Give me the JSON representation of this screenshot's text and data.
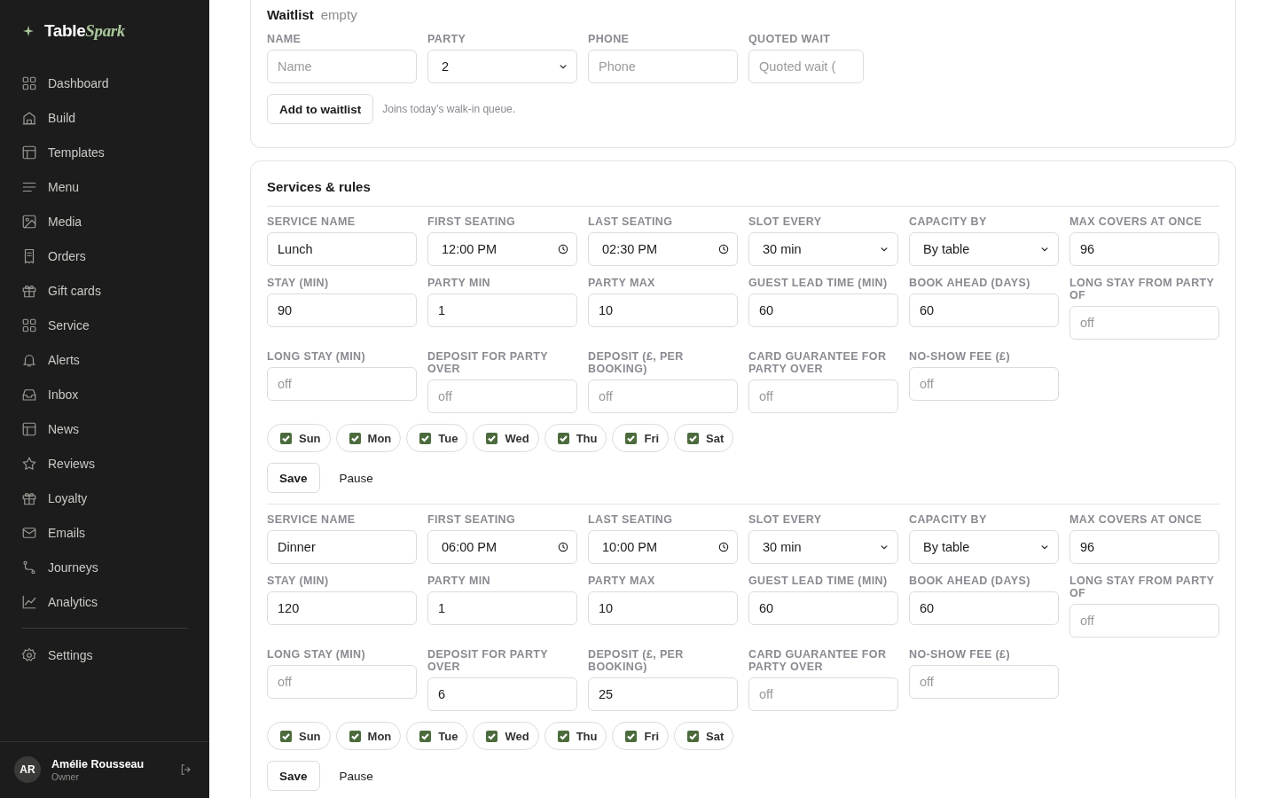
{
  "sidebar": {
    "logo": {
      "plain": "Table",
      "accent": "Spark"
    },
    "items": [
      {
        "label": "Dashboard"
      },
      {
        "label": "Build"
      },
      {
        "label": "Templates"
      },
      {
        "label": "Menu"
      },
      {
        "label": "Media"
      },
      {
        "label": "Orders"
      },
      {
        "label": "Gift cards"
      },
      {
        "label": "Service"
      },
      {
        "label": "Alerts"
      },
      {
        "label": "Inbox"
      },
      {
        "label": "News"
      },
      {
        "label": "Reviews"
      },
      {
        "label": "Loyalty"
      },
      {
        "label": "Emails"
      },
      {
        "label": "Journeys"
      },
      {
        "label": "Analytics"
      }
    ],
    "footer_items": [
      {
        "label": "Settings"
      }
    ],
    "user": {
      "initials": "AR",
      "name": "Amélie Rousseau",
      "role": "Owner"
    }
  },
  "waitlist": {
    "title": "Waitlist",
    "status": "empty",
    "fields": [
      {
        "label": "NAME",
        "kind": "text",
        "placeholder": "Name"
      },
      {
        "label": "PARTY",
        "kind": "select",
        "value": "2"
      },
      {
        "label": "PHONE",
        "kind": "text",
        "placeholder": "Phone"
      },
      {
        "label": "QUOTED WAIT",
        "kind": "text",
        "placeholder": "Quoted wait ("
      }
    ],
    "button": "Add to waitlist",
    "hint": "Joins today’s walk-in queue."
  },
  "services": {
    "title": "Services & rules",
    "items": [
      {
        "fields": [
          {
            "label": "SERVICE NAME",
            "kind": "text",
            "value": "Lunch"
          },
          {
            "label": "FIRST SEATING",
            "kind": "time",
            "value": "12:00 PM"
          },
          {
            "label": "LAST SEATING",
            "kind": "time",
            "value": "02:30 PM"
          },
          {
            "label": "SLOT EVERY",
            "kind": "select",
            "value": "30 min"
          },
          {
            "label": "CAPACITY BY",
            "kind": "select",
            "value": "By table"
          },
          {
            "label": "MAX COVERS AT ONCE",
            "kind": "text",
            "value": "96"
          },
          {
            "label": "STAY (MIN)",
            "kind": "text",
            "value": "90"
          },
          {
            "label": "PARTY MIN",
            "kind": "text",
            "value": "1"
          },
          {
            "label": "PARTY MAX",
            "kind": "text",
            "value": "10"
          },
          {
            "label": "GUEST LEAD TIME (MIN)",
            "kind": "text",
            "value": "60"
          },
          {
            "label": "BOOK AHEAD (DAYS)",
            "kind": "text",
            "value": "60"
          },
          {
            "label": "LONG STAY FROM PARTY OF",
            "kind": "text",
            "placeholder": "off"
          },
          {
            "label": "LONG STAY (MIN)",
            "kind": "text",
            "placeholder": "off"
          },
          {
            "label": "DEPOSIT FOR PARTY OVER",
            "kind": "text",
            "placeholder": "off"
          },
          {
            "label": "DEPOSIT (£, PER BOOKING)",
            "kind": "text",
            "placeholder": "off"
          },
          {
            "label": "CARD GUARANTEE FOR PARTY OVER",
            "kind": "text",
            "placeholder": "off"
          },
          {
            "label": "NO-SHOW FEE (£)",
            "kind": "text",
            "placeholder": "off"
          }
        ],
        "days": [
          {
            "label": "Sun",
            "checked": true
          },
          {
            "label": "Mon",
            "checked": true
          },
          {
            "label": "Tue",
            "checked": true
          },
          {
            "label": "Wed",
            "checked": true
          },
          {
            "label": "Thu",
            "checked": true
          },
          {
            "label": "Fri",
            "checked": true
          },
          {
            "label": "Sat",
            "checked": true
          }
        ],
        "buttons": [
          "Save",
          "Pause"
        ]
      },
      {
        "fields": [
          {
            "label": "SERVICE NAME",
            "kind": "text",
            "value": "Dinner"
          },
          {
            "label": "FIRST SEATING",
            "kind": "time",
            "value": "06:00 PM"
          },
          {
            "label": "LAST SEATING",
            "kind": "time",
            "value": "10:00 PM"
          },
          {
            "label": "SLOT EVERY",
            "kind": "select",
            "value": "30 min"
          },
          {
            "label": "CAPACITY BY",
            "kind": "select",
            "value": "By table"
          },
          {
            "label": "MAX COVERS AT ONCE",
            "kind": "text",
            "value": "96"
          },
          {
            "label": "STAY (MIN)",
            "kind": "text",
            "value": "120"
          },
          {
            "label": "PARTY MIN",
            "kind": "text",
            "value": "1"
          },
          {
            "label": "PARTY MAX",
            "kind": "text",
            "value": "10"
          },
          {
            "label": "GUEST LEAD TIME (MIN)",
            "kind": "text",
            "value": "60"
          },
          {
            "label": "BOOK AHEAD (DAYS)",
            "kind": "text",
            "value": "60"
          },
          {
            "label": "LONG STAY FROM PARTY OF",
            "kind": "text",
            "placeholder": "off"
          },
          {
            "label": "LONG STAY (MIN)",
            "kind": "text",
            "placeholder": "off"
          },
          {
            "label": "DEPOSIT FOR PARTY OVER",
            "kind": "text",
            "value": "6"
          },
          {
            "label": "DEPOSIT (£, PER BOOKING)",
            "kind": "text",
            "value": "25"
          },
          {
            "label": "CARD GUARANTEE FOR PARTY OVER",
            "kind": "text",
            "placeholder": "off"
          },
          {
            "label": "NO-SHOW FEE (£)",
            "kind": "text",
            "placeholder": "off"
          }
        ],
        "days": [
          {
            "label": "Sun",
            "checked": true
          },
          {
            "label": "Mon",
            "checked": true
          },
          {
            "label": "Tue",
            "checked": true
          },
          {
            "label": "Wed",
            "checked": true
          },
          {
            "label": "Thu",
            "checked": true
          },
          {
            "label": "Fri",
            "checked": true
          },
          {
            "label": "Sat",
            "checked": true
          }
        ],
        "buttons": [
          "Save",
          "Pause"
        ]
      }
    ]
  }
}
